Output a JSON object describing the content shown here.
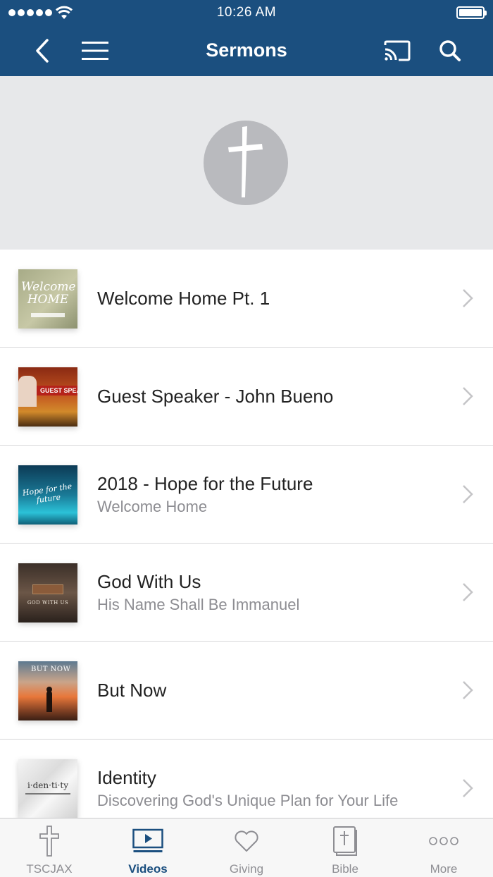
{
  "status_bar": {
    "time": "10:26 AM"
  },
  "nav": {
    "title": "Sermons"
  },
  "sermons": [
    {
      "title": "Welcome Home Pt. 1",
      "subtitle": "",
      "thumb_text": "Welcome HOME"
    },
    {
      "title": "Guest Speaker - John Bueno",
      "subtitle": "",
      "thumb_text": "GUEST SPEA MISSIONARY JOHN B"
    },
    {
      "title": "2018 - Hope for the Future",
      "subtitle": "Welcome Home",
      "thumb_text": "Hope for the future"
    },
    {
      "title": "God With Us",
      "subtitle": "His Name Shall Be Immanuel",
      "thumb_text": "GOD WITH US"
    },
    {
      "title": "But Now",
      "subtitle": "",
      "thumb_text": "BUT NOW"
    },
    {
      "title": "Identity",
      "subtitle": "Discovering God's Unique Plan for Your Life",
      "thumb_text": "i·den·ti·ty"
    }
  ],
  "tabs": [
    {
      "label": "TSCJAX",
      "icon": "cross-icon"
    },
    {
      "label": "Videos",
      "icon": "video-icon",
      "active": true
    },
    {
      "label": "Giving",
      "icon": "heart-icon"
    },
    {
      "label": "Bible",
      "icon": "bible-icon"
    },
    {
      "label": "More",
      "icon": "more-icon"
    }
  ],
  "colors": {
    "brand": "#1b4f7f",
    "hero_bg": "#e7e8ea",
    "divider": "#d7d7d9",
    "inactive": "#8e8e93"
  }
}
